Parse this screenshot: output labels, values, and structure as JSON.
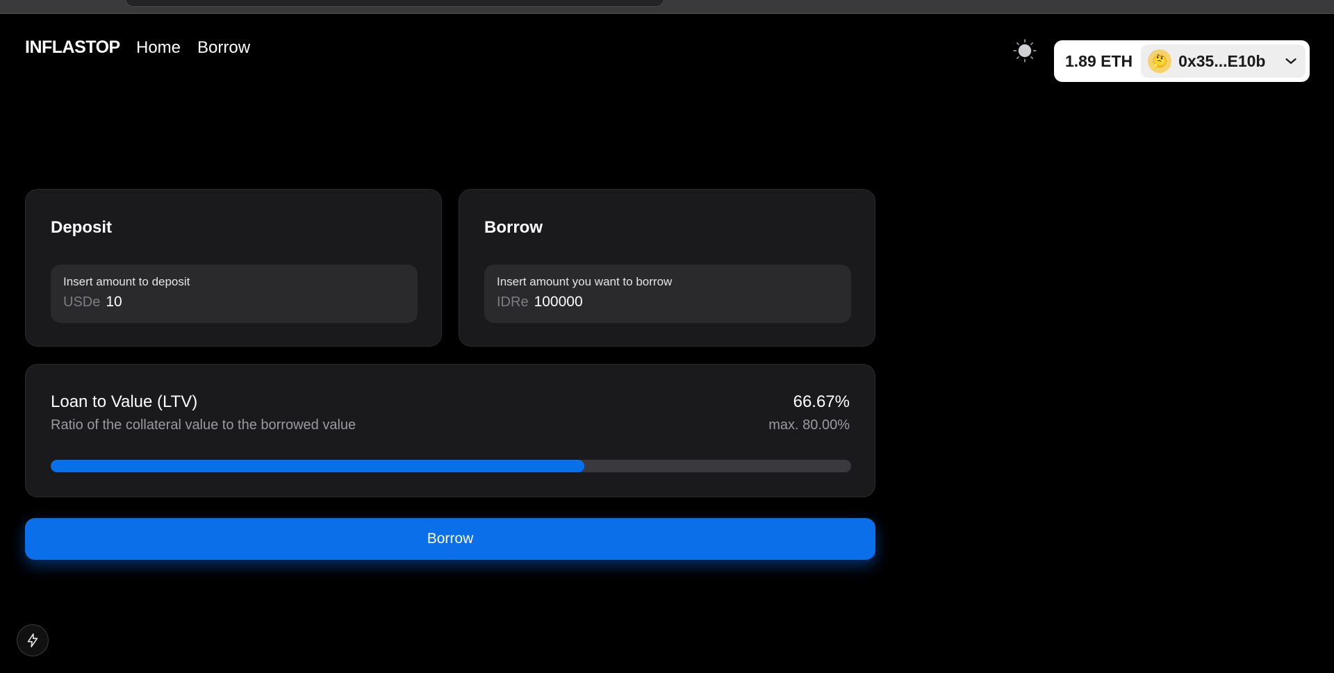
{
  "nav": {
    "brand": "INFLASTOP",
    "links": [
      {
        "label": "Home"
      },
      {
        "label": "Borrow"
      }
    ]
  },
  "theme_toggle": {
    "icon": "sun-icon"
  },
  "wallet": {
    "balance": "1.89 ETH",
    "avatar": "🤔",
    "address": "0x35...E10b",
    "avatar_color": "#f5d36a"
  },
  "deposit": {
    "title": "Deposit",
    "input_label": "Insert amount to deposit",
    "unit": "USDe",
    "value": "10"
  },
  "borrow": {
    "title": "Borrow",
    "input_label": "Insert amount you want to borrow",
    "unit": "IDRe",
    "value": "100000"
  },
  "ltv": {
    "title": "Loan to Value (LTV)",
    "subtitle": "Ratio of the collateral value to the borrowed value",
    "value": "66.67%",
    "max": "max. 80.00%",
    "progress_percent": 66.67,
    "bar_color": "#0870e8"
  },
  "action": {
    "borrow_label": "Borrow",
    "color": "#0a6fe8"
  }
}
